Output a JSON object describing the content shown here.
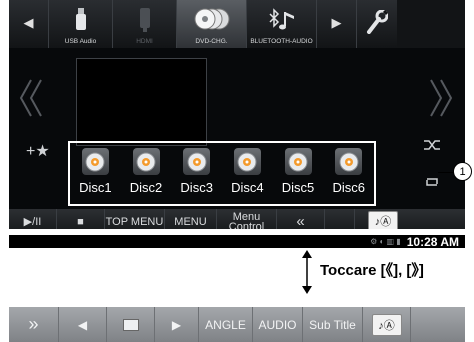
{
  "topbar": {
    "left_arrow": "◀",
    "right_arrow": "▶",
    "sources": [
      {
        "label": "USB Audio",
        "icon": "usb-stick-icon",
        "state": "normal"
      },
      {
        "label": "HDMI",
        "icon": "hdmi-icon",
        "state": "disabled"
      },
      {
        "label": "DVD-CHG.",
        "icon": "dvd-changer-icon",
        "state": "active"
      },
      {
        "label": "BLUETOOTH-AUDIO",
        "icon": "bluetooth-music-icon",
        "state": "normal"
      }
    ],
    "setup_icon": "setup-wrench-icon"
  },
  "shortcut": {
    "star": "+★"
  },
  "discs": [
    "Disc1",
    "Disc2",
    "Disc3",
    "Disc4",
    "Disc5",
    "Disc6"
  ],
  "controls": {
    "play_pause": "▶/II",
    "stop": "■",
    "top_menu": "TOP MENU",
    "menu": "MENU",
    "menu_control": "Menu Control",
    "back": "«"
  },
  "status": {
    "time": "10:28 AM"
  },
  "callout": {
    "number": "1"
  },
  "instruction": "Toccare [《], [》]",
  "alt_bar": {
    "forward": "»",
    "prev": "◀",
    "next": "▶",
    "angle": "ANGLE",
    "audio": "AUDIO",
    "subtitle": "Sub Title"
  },
  "colors": {
    "screen_bg": "#07090b",
    "accent": "#ffffff",
    "alt_bar": "#8f9296"
  }
}
